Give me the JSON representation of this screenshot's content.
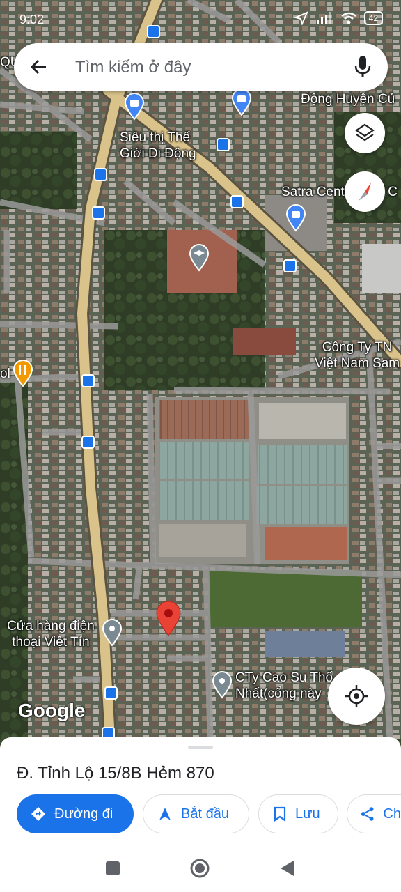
{
  "status_bar": {
    "time": "9:02",
    "battery": "42"
  },
  "search": {
    "placeholder": "Tìm kiếm ở đây"
  },
  "map_labels": {
    "qu": "QU",
    "sieu_thi": "Siêu thị Thế\nGiới Di Động",
    "lao_dong": "Lao\nĐộng Huyện Củ",
    "satra": "Satra Centre Mall C",
    "cong_ty": "Công Ty TN\nViệt Nam Sam",
    "ol": "ol",
    "cua_hang": "Cửa hàng điện\nthoại Việt Tín",
    "cty_cao_su": "CTy Cao Su Thố\nNhất(cổng này",
    "google": "Google"
  },
  "sheet": {
    "place_name": "Đ. Tỉnh Lộ 15/8B Hẻm 870",
    "directions_label": "Đường đi",
    "start_label": "Bắt đầu",
    "save_label": "Lưu",
    "share_label": "Ch"
  },
  "colors": {
    "accent": "#1a73e8",
    "pin": "#ea4335",
    "road": "#d9c38b"
  },
  "icons": [
    "back-arrow-icon",
    "mic-icon",
    "layers-icon",
    "compass-icon",
    "my-location-icon"
  ]
}
